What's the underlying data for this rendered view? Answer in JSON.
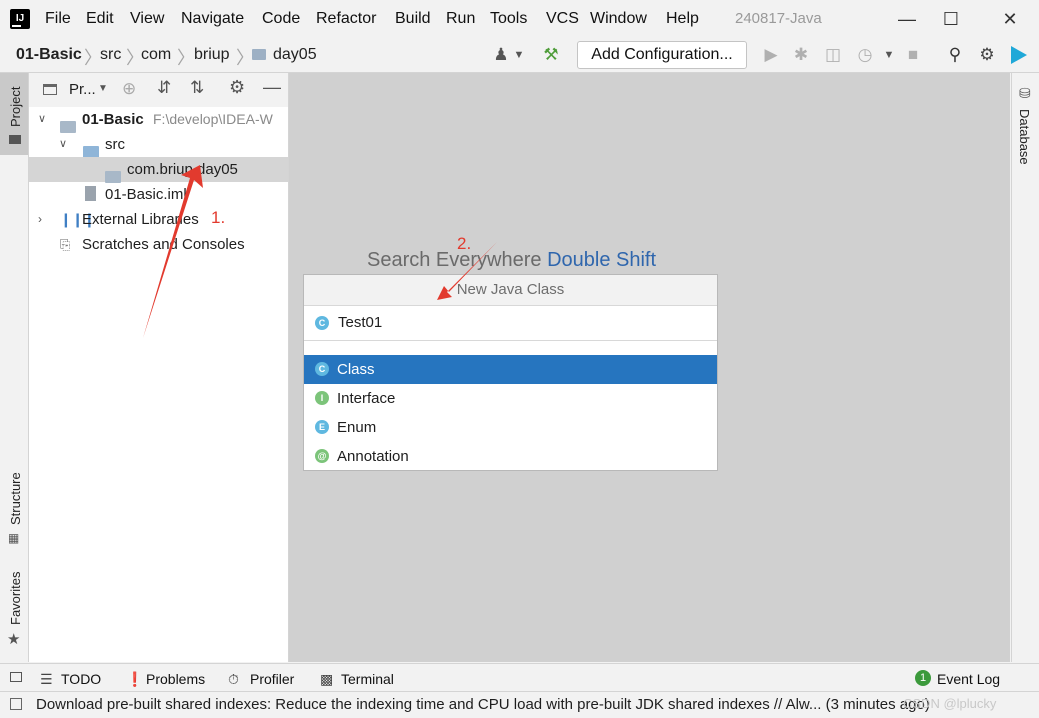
{
  "menu": {
    "items": [
      "File",
      "Edit",
      "View",
      "Navigate",
      "Code",
      "Refactor",
      "Build",
      "Run",
      "Tools",
      "VCS",
      "Window",
      "Help"
    ],
    "window_title": "240817-Java"
  },
  "nav": {
    "breadcrumbs": [
      "01-Basic",
      "src",
      "com",
      "briup",
      "day05"
    ],
    "add_configuration": "Add Configuration..."
  },
  "stripes": {
    "project": "Project",
    "structure": "Structure",
    "favorites": "Favorites",
    "database": "Database"
  },
  "project_panel": {
    "header_label": "Pr...",
    "tree": {
      "root_name": "01-Basic",
      "root_path": "F:\\develop\\IDEA-W",
      "src": "src",
      "package": "com.briup.day05",
      "iml": "01-Basic.iml",
      "external_libraries": "External Libraries",
      "scratches": "Scratches and Consoles"
    }
  },
  "editor": {
    "search_hint": "Search Everywhere",
    "search_shortcut": "Double Shift"
  },
  "popup": {
    "title": "New Java Class",
    "name_value": "Test01",
    "kinds": [
      {
        "label": "Class",
        "badge": "C",
        "color": "#5fb8e0"
      },
      {
        "label": "Interface",
        "badge": "I",
        "color": "#7cc47a"
      },
      {
        "label": "Enum",
        "badge": "E",
        "color": "#5fb8e0"
      },
      {
        "label": "Annotation",
        "badge": "@",
        "color": "#7cc47a"
      }
    ],
    "selected_index": 0
  },
  "annotations": {
    "step1": "1.",
    "step2": "2.",
    "color": "#e23a2e"
  },
  "bottom_tools": {
    "todo": "TODO",
    "problems": "Problems",
    "profiler": "Profiler",
    "terminal": "Terminal",
    "event_log": "Event Log",
    "event_count": "1"
  },
  "status": {
    "text": "Download pre-built shared indexes: Reduce the indexing time and CPU load with pre-built JDK shared indexes // Alw... (3 minutes ago)",
    "watermark": "CSDN @lplucky"
  }
}
